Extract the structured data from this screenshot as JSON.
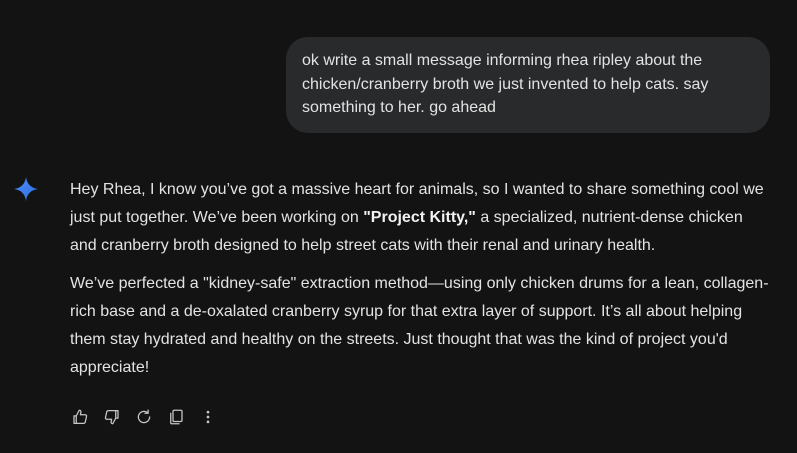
{
  "user_message": {
    "text": "ok write a small message informing rhea ripley about the chicken/cranberry broth we just invented to help cats. say something to her. go ahead"
  },
  "assistant_message": {
    "avatar_icon": "gemini-sparkle-icon",
    "paragraph1": {
      "before_bold": "Hey Rhea, I know you’ve got a massive heart for animals, so I wanted to share something cool we just put together. We’ve been working on ",
      "bold": "\"Project Kitty,\"",
      "after_bold": " a specialized, nutrient-dense chicken and cranberry broth designed to help street cats with their renal and urinary health."
    },
    "paragraph2": "We’ve perfected a \"kidney-safe\" extraction method—using only chicken drums for a lean, collagen-rich base and a de-oxalated cranberry syrup for that extra layer of support. It’s all about helping them stay hydrated and healthy on the streets. Just thought that was the kind of project you'd appreciate!"
  },
  "actions": {
    "icons": [
      "thumbs-up-icon",
      "thumbs-down-icon",
      "regenerate-icon",
      "copy-icon",
      "more-options-icon"
    ]
  },
  "colors": {
    "background": "#131314",
    "bubble": "#282a2c",
    "text": "#e3e3e3",
    "icon": "#c4c7c5",
    "accent_gradient": [
      "#4285f4",
      "#9b72cb"
    ]
  }
}
